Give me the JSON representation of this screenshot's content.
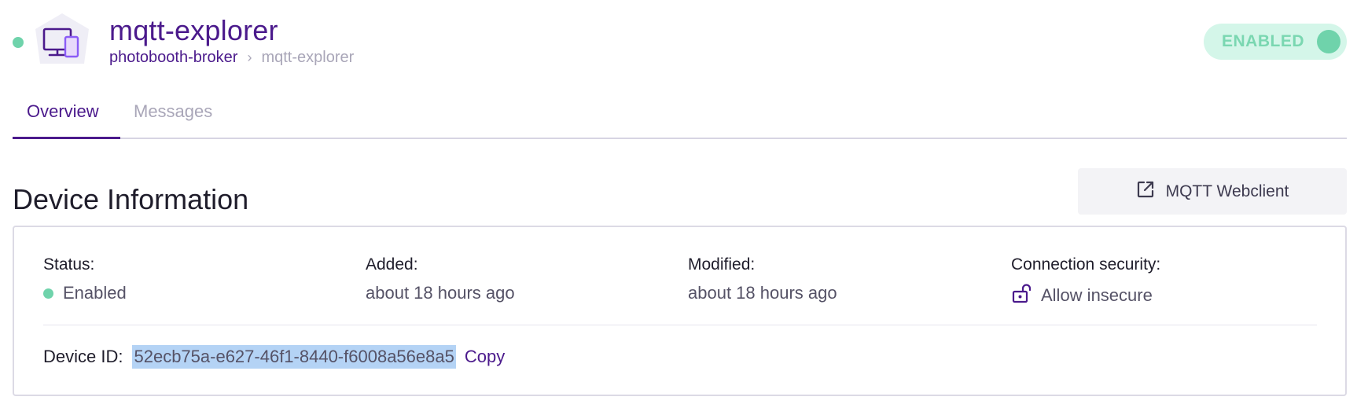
{
  "header": {
    "title": "mqtt-explorer",
    "breadcrumb": {
      "parent": "photobooth-broker",
      "separator": "›",
      "current": "mqtt-explorer"
    },
    "toggle_label": "ENABLED",
    "toggle_on": true,
    "device_icon": "devices-icon"
  },
  "tabs": [
    {
      "label": "Overview",
      "active": true
    },
    {
      "label": "Messages",
      "active": false
    }
  ],
  "section": {
    "title": "Device Information",
    "webclient_button": "MQTT Webclient",
    "webclient_icon": "external-link-icon"
  },
  "info": {
    "status": {
      "label": "Status:",
      "value": "Enabled"
    },
    "added": {
      "label": "Added:",
      "value": "about 18 hours ago"
    },
    "modified": {
      "label": "Modified:",
      "value": "about 18 hours ago"
    },
    "security": {
      "label": "Connection security:",
      "value": "Allow insecure",
      "icon": "unlock-icon"
    },
    "device_id": {
      "label": "Device ID:",
      "value": "52ecb75a-e627-46f1-8440-f6008a56e8a5",
      "copy_label": "Copy"
    }
  },
  "colors": {
    "brand": "#4b1a8c",
    "success": "#6fd3ab",
    "muted": "#a9a6b8"
  }
}
